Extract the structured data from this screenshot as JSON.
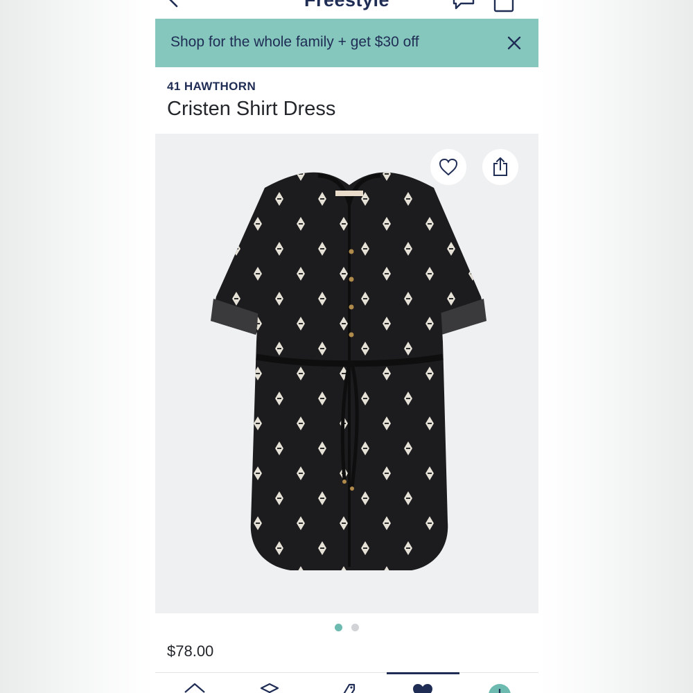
{
  "nav": {
    "title": "Freestyle",
    "icons": {
      "back": "chevron-left-icon",
      "chat": "chat-bubble-icon",
      "bag": "shopping-bag-icon"
    }
  },
  "promo": {
    "text": "Shop for the whole family + get $30 off",
    "close_icon": "close-icon",
    "color": "#85c6bd"
  },
  "product": {
    "brand": "41 HAWTHORN",
    "name": "Cristen Shirt Dress",
    "price": "$78.00",
    "image_count": 2,
    "active_image": 1,
    "favorite_icon": "heart-outline-icon",
    "share_icon": "share-icon"
  },
  "tabbar": {
    "active_tab": "favorites",
    "icons": [
      "home-icon",
      "box-icon",
      "tag-icon",
      "heart-filled-icon",
      "add-circle-icon"
    ]
  },
  "colors": {
    "navy": "#1f2d55",
    "accent": "#85c6bd",
    "dot_active": "#6dbab0"
  }
}
